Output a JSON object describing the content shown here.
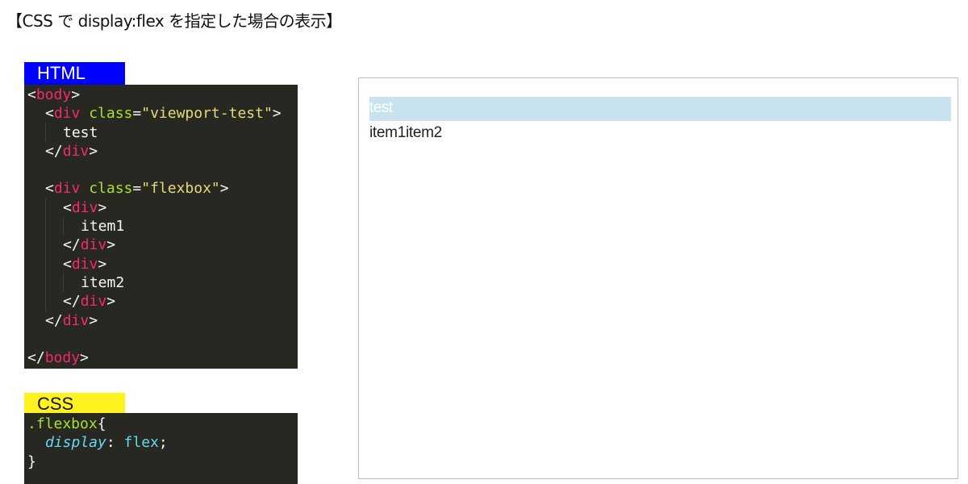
{
  "page": {
    "title": "【CSS で display:flex を指定した場合の表示】"
  },
  "html_panel": {
    "label": "HTML",
    "lines": {
      "l1_open_bracket": "<",
      "l1_tag": "body",
      "l1_close_bracket": ">",
      "l2_open_bracket": "<",
      "l2_tag": "div",
      "l2_attr": "class",
      "l2_eq": "=",
      "l2_value": "\"viewport-test\"",
      "l2_close_bracket": ">",
      "l3_text": "test",
      "l4_open_bracket": "</",
      "l4_tag": "div",
      "l4_close_bracket": ">",
      "l6_open_bracket": "<",
      "l6_tag": "div",
      "l6_attr": "class",
      "l6_eq": "=",
      "l6_value": "\"flexbox\"",
      "l6_close_bracket": ">",
      "l7_open_bracket": "<",
      "l7_tag": "div",
      "l7_close_bracket": ">",
      "l8_text": "item1",
      "l9_open_bracket": "</",
      "l9_tag": "div",
      "l9_close_bracket": ">",
      "l10_open_bracket": "<",
      "l10_tag": "div",
      "l10_close_bracket": ">",
      "l11_text": "item2",
      "l12_open_bracket": "</",
      "l12_tag": "div",
      "l12_close_bracket": ">",
      "l13_open_bracket": "</",
      "l13_tag": "div",
      "l13_close_bracket": ">",
      "l15_open_bracket": "</",
      "l15_tag": "body",
      "l15_close_bracket": ">"
    }
  },
  "css_panel": {
    "label": "CSS",
    "selector": ".flexbox",
    "open_brace": "{",
    "property": "display",
    "colon": ": ",
    "value": "flex",
    "semicolon": ";",
    "close_brace": "}"
  },
  "preview": {
    "viewport_test_text": "test",
    "items": [
      "item1",
      "item2"
    ]
  },
  "colors": {
    "html_label_bg": "#0000ff",
    "css_label_bg": "#fff21e",
    "code_bg": "#272822",
    "tag": "#f92672",
    "attr": "#a6e22e",
    "string": "#e6db74",
    "property": "#66d9ef",
    "viewport_test_bg": "#c9e3ee"
  }
}
